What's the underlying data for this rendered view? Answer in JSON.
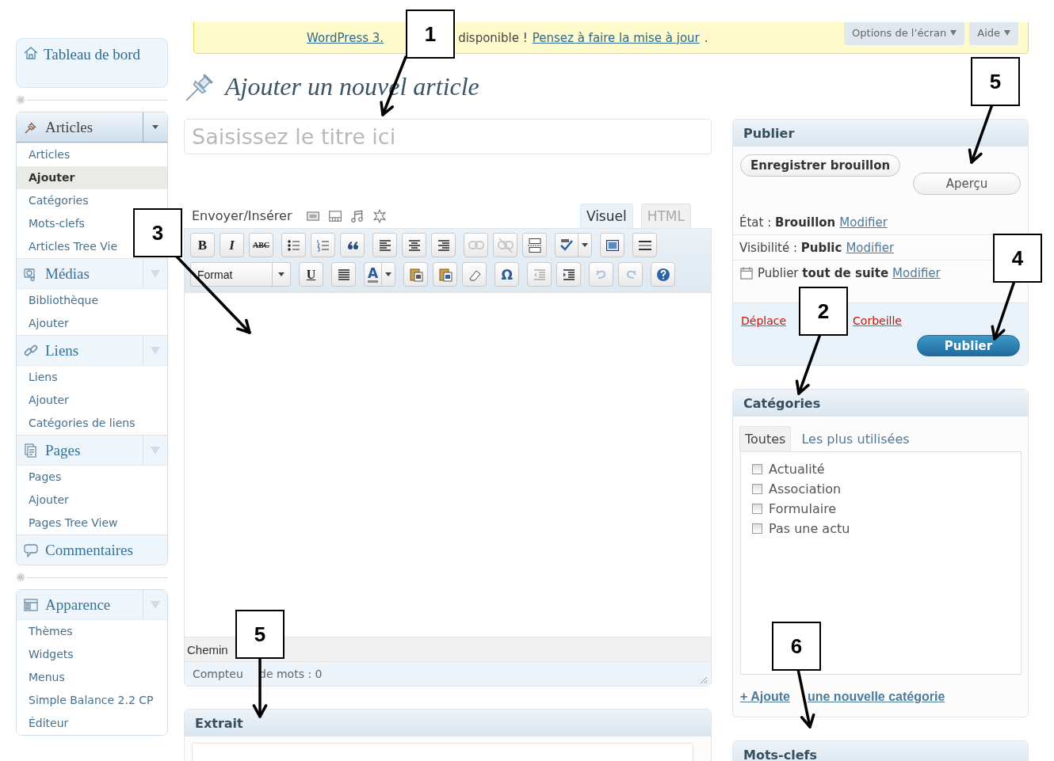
{
  "notice": {
    "parts": [
      {
        "kind": "link",
        "text": "WordPress 3."
      },
      {
        "kind": "gap"
      },
      {
        "kind": "text",
        "text": "disponible !"
      },
      {
        "kind": "link",
        "text": "Pensez à faire la mise à jour"
      },
      {
        "kind": "text",
        "text": "."
      }
    ]
  },
  "screen_tabs": [
    {
      "label": "Options de l’écran"
    },
    {
      "label": "Aide"
    }
  ],
  "sidebar": {
    "dashboard": "Tableau de bord",
    "sections": [
      {
        "menus": [
          {
            "title": "Articles",
            "current": true,
            "items": [
              {
                "label": "Articles",
                "selected": false
              },
              {
                "label": "Ajouter",
                "selected": true
              },
              {
                "label": "Catégories",
                "selected": false
              },
              {
                "label": "Mots-clefs",
                "selected": false
              },
              {
                "label": "Articles Tree Vie",
                "selected": false
              }
            ]
          },
          {
            "title": "Médias",
            "current": false,
            "items": [
              {
                "label": "Bibliothèque",
                "selected": false
              },
              {
                "label": "Ajouter",
                "selected": false
              }
            ]
          },
          {
            "title": "Liens",
            "current": false,
            "items": [
              {
                "label": "Liens",
                "selected": false
              },
              {
                "label": "Ajouter",
                "selected": false
              },
              {
                "label": "Catégories de liens",
                "selected": false
              }
            ]
          },
          {
            "title": "Pages",
            "current": false,
            "items": [
              {
                "label": "Pages",
                "selected": false
              },
              {
                "label": "Ajouter",
                "selected": false
              },
              {
                "label": "Pages Tree View",
                "selected": false
              }
            ]
          },
          {
            "title": "Commentaires",
            "current": false
          }
        ]
      },
      {
        "menus": [
          {
            "title": "Apparence",
            "current": false,
            "items": [
              {
                "label": "Thèmes",
                "selected": false
              },
              {
                "label": "Widgets",
                "selected": false
              },
              {
                "label": "Menus",
                "selected": false
              },
              {
                "label": "Simple Balance 2.2 CP",
                "selected": false
              },
              {
                "label": "Éditeur",
                "selected": false
              }
            ]
          }
        ]
      }
    ]
  },
  "page_title": "Ajouter un nouvel article",
  "title_field": {
    "placeholder": "Saisissez le titre ici"
  },
  "upload": {
    "label": "Envoyer/Insérer"
  },
  "editor": {
    "tabs": [
      {
        "label": "Visuel",
        "selected": true
      },
      {
        "label": "HTML",
        "selected": false
      }
    ],
    "toolbar": [
      [
        [
          {
            "kind": "bold",
            "label": "B",
            "disabled": false
          },
          {
            "kind": "italic",
            "label": "I",
            "disabled": false
          },
          {
            "kind": "strike",
            "label": "ABC",
            "disabled": false
          }
        ],
        [
          {
            "kind": "bullets",
            "disabled": false
          },
          {
            "kind": "numbers",
            "disabled": false
          },
          {
            "kind": "quote",
            "disabled": false
          }
        ],
        [
          {
            "kind": "align-left",
            "disabled": false
          },
          {
            "kind": "align-center",
            "disabled": false
          },
          {
            "kind": "align-right",
            "disabled": false
          }
        ],
        [
          {
            "kind": "link",
            "disabled": true
          },
          {
            "kind": "unlink",
            "disabled": true
          },
          {
            "kind": "more",
            "disabled": false
          }
        ],
        [
          {
            "kind": "spell",
            "disabled": false
          }
        ],
        [
          {
            "kind": "fullscreen",
            "disabled": false
          }
        ],
        [
          {
            "kind": "kitchen",
            "disabled": false
          }
        ]
      ],
      [
        [
          {
            "kind": "format",
            "label": "Format",
            "disabled": false
          }
        ],
        [
          {
            "kind": "underline",
            "label": "U",
            "disabled": false
          }
        ],
        [
          {
            "kind": "justify",
            "disabled": false
          }
        ],
        [
          {
            "kind": "color",
            "label": "A",
            "disabled": false
          }
        ],
        [
          {
            "kind": "paste-text",
            "disabled": false
          },
          {
            "kind": "paste-word",
            "disabled": false
          },
          {
            "kind": "eraser",
            "disabled": false
          }
        ],
        [
          {
            "kind": "omega",
            "label": "Ω",
            "disabled": false
          }
        ],
        [
          {
            "kind": "outdent",
            "disabled": true
          },
          {
            "kind": "indent",
            "disabled": false
          }
        ],
        [
          {
            "kind": "undo",
            "disabled": true
          },
          {
            "kind": "redo",
            "disabled": true
          }
        ],
        [
          {
            "kind": "help",
            "disabled": false
          }
        ]
      ]
    ],
    "path": "Chemin",
    "word_count": [
      "Compteu",
      "de mots : 0"
    ]
  },
  "excerpt": {
    "title": "Extrait"
  },
  "publish": {
    "title": "Publier",
    "save_draft": "Enregistrer brouillon",
    "preview": "Aperçu",
    "rows": [
      {
        "label": "État :",
        "value": "Brouillon",
        "link": "Modifier"
      },
      {
        "label": "Visibilité :",
        "value": "Public",
        "link": "Modifier"
      },
      {
        "label": "Publier",
        "value": "tout de suite",
        "link": "Modifier"
      }
    ],
    "trash": [
      "Déplace",
      "Corbeille"
    ],
    "button": "Publier"
  },
  "categories": {
    "title": "Catégories",
    "tabs": [
      {
        "label": "Toutes",
        "selected": true
      },
      {
        "label": "Les plus utilisées",
        "selected": false
      }
    ],
    "items": [
      {
        "label": "Actualité",
        "checked": false
      },
      {
        "label": "Association",
        "checked": false
      },
      {
        "label": "Formulaire",
        "checked": false
      },
      {
        "label": "Pas une actu",
        "checked": false
      }
    ],
    "add_link": [
      "+ Ajoute",
      "une nouvelle catégorie"
    ]
  },
  "tags": {
    "title": "Mots-clefs"
  },
  "callouts": [
    {
      "number": "1"
    },
    {
      "number": "5"
    },
    {
      "number": "3"
    },
    {
      "number": "4"
    },
    {
      "number": "2"
    },
    {
      "number": "5"
    },
    {
      "number": "6"
    }
  ]
}
